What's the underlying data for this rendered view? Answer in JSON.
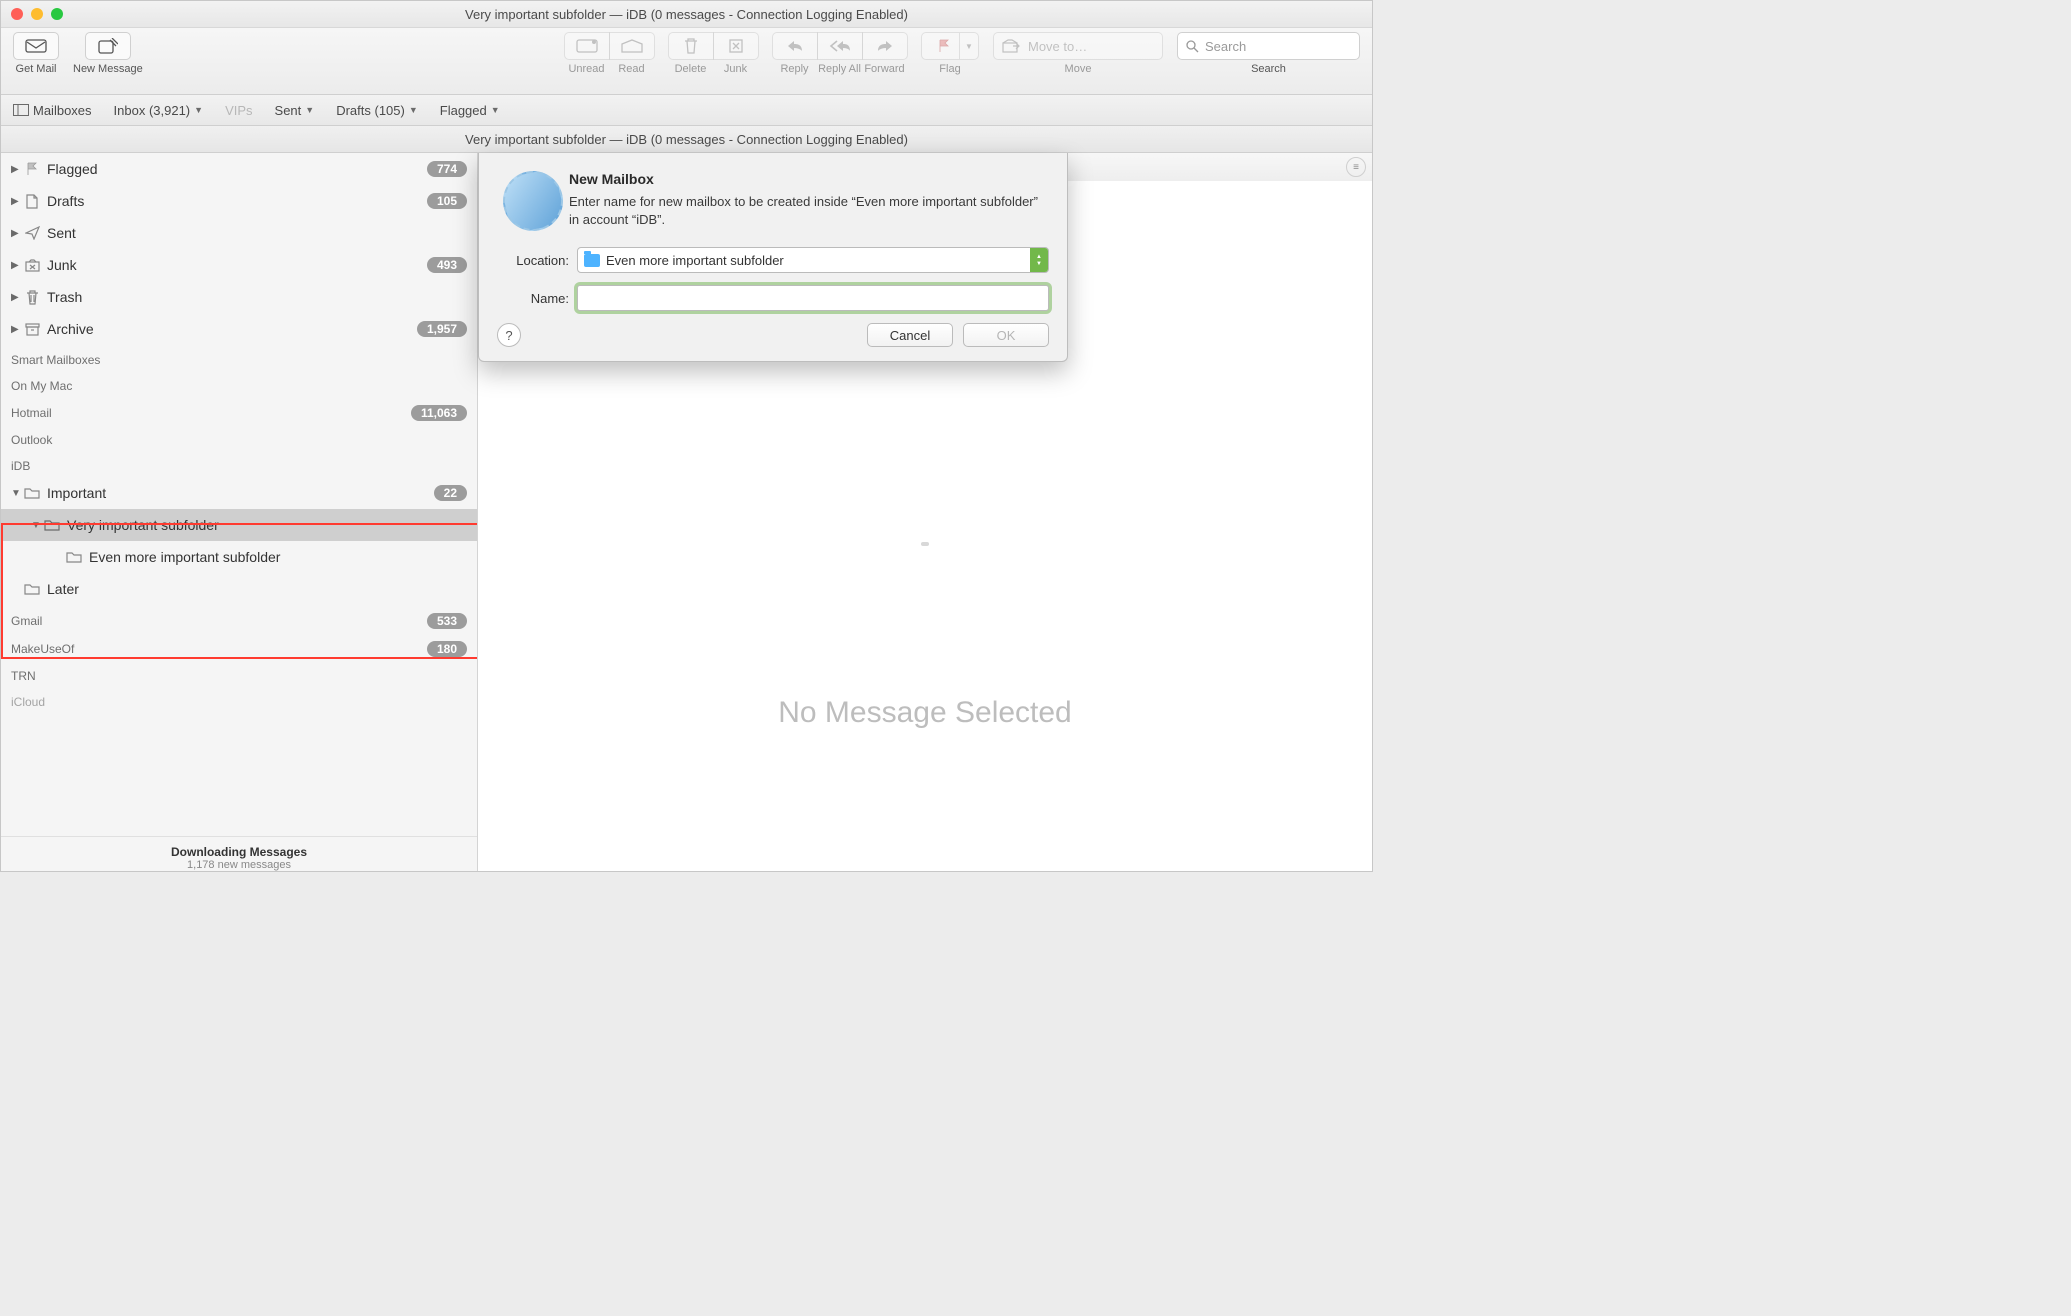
{
  "window_title": "Very important subfolder — iDB (0 messages - Connection Logging Enabled)",
  "toolbar": {
    "get_mail": "Get Mail",
    "new_message": "New Message",
    "unread": "Unread",
    "read": "Read",
    "delete": "Delete",
    "junk": "Junk",
    "reply": "Reply",
    "reply_all": "Reply All",
    "forward": "Forward",
    "flag": "Flag",
    "move": "Move",
    "move_placeholder": "Move to…",
    "search": "Search",
    "search_placeholder": "Search"
  },
  "favorites": {
    "mailboxes": "Mailboxes",
    "inbox": "Inbox (3,921)",
    "vips": "VIPs",
    "sent": "Sent",
    "drafts": "Drafts (105)",
    "flagged": "Flagged"
  },
  "infobar": "Very important subfolder — iDB (0 messages - Connection Logging Enabled)",
  "sidebar": {
    "flagged": {
      "label": "Flagged",
      "badge": "774"
    },
    "drafts": {
      "label": "Drafts",
      "badge": "105"
    },
    "sent": {
      "label": "Sent"
    },
    "junk": {
      "label": "Junk",
      "badge": "493"
    },
    "trash": {
      "label": "Trash"
    },
    "archive": {
      "label": "Archive",
      "badge": "1,957"
    },
    "sections": {
      "smart": "Smart Mailboxes",
      "onmymac": "On My Mac",
      "hotmail": "Hotmail",
      "outlook": "Outlook",
      "idb": "iDB",
      "gmail": "Gmail",
      "makeuseof": "MakeUseOf",
      "trn": "TRN",
      "icloud": "iCloud"
    },
    "hotmail_badge": "11,063",
    "idb": {
      "important": {
        "label": "Important",
        "badge": "22"
      },
      "very": {
        "label": "Very important subfolder"
      },
      "evenmore": {
        "label": "Even more important subfolder"
      },
      "later": {
        "label": "Later"
      }
    },
    "gmail_badge": "533",
    "makeuseof_badge": "180",
    "footer": {
      "l1": "Downloading Messages",
      "l2": "1,178 new messages"
    }
  },
  "main": {
    "no_message": "No Message Selected"
  },
  "dialog": {
    "title": "New Mailbox",
    "desc": "Enter name for new mailbox to be created inside “Even more important subfolder” in account “iDB”.",
    "location_label": "Location:",
    "location_value": "Even more important subfolder",
    "name_label": "Name:",
    "name_value": "",
    "cancel": "Cancel",
    "ok": "OK",
    "help": "?"
  }
}
